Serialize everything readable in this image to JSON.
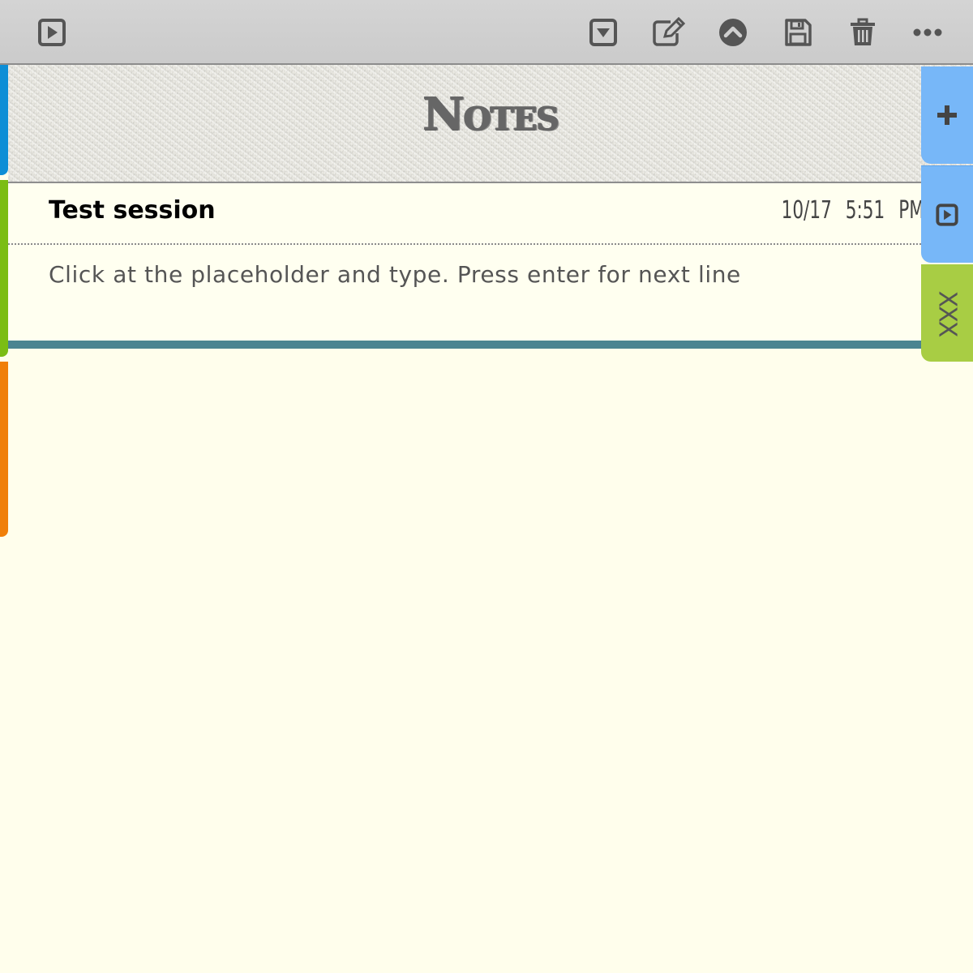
{
  "header": {
    "title": "Notes"
  },
  "note": {
    "title": "Test session",
    "date": "10/17",
    "time": "5:51 PM",
    "body": "Click at the placeholder and type. Press enter for next line"
  },
  "side_tabs": {
    "xxx_label": "XXX"
  },
  "toolbar": {
    "icons": [
      "play-square-icon",
      "caret-down-square-icon",
      "edit-icon",
      "chevron-up-circle-icon",
      "save-icon",
      "trash-icon",
      "more-horizontal-icon"
    ]
  },
  "colors": {
    "toolbar_bg": "#cfcfcf",
    "page_bg": "#fffeec",
    "accent_teal": "#4a8491",
    "tab_blue": "#77b7f8",
    "tab_green": "#a8cd44",
    "left_blue": "#0d8ed6",
    "left_green": "#7bbd14",
    "left_orange": "#f07f0a",
    "icon_gray": "#555555"
  }
}
